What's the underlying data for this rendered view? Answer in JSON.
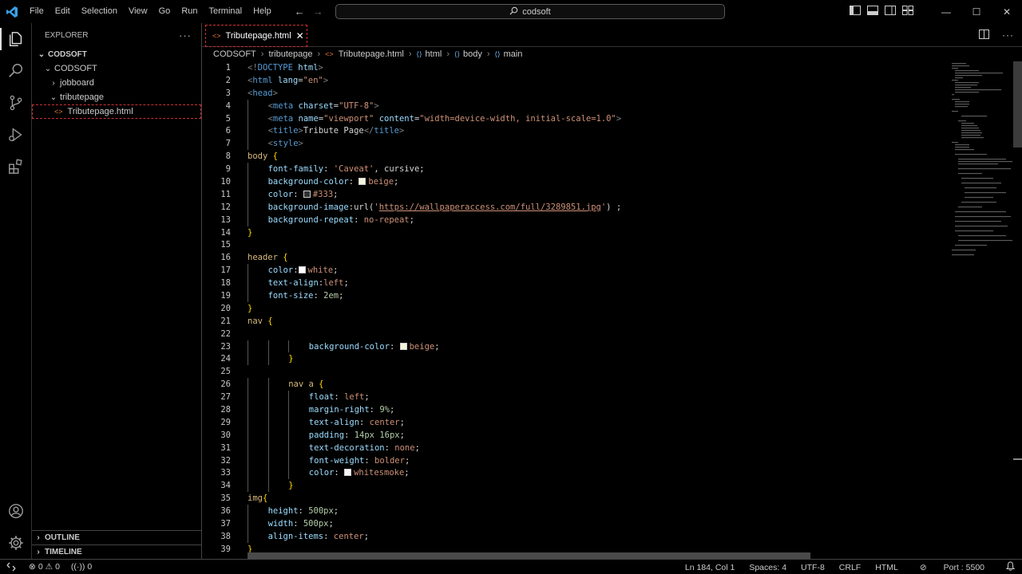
{
  "menu": [
    "File",
    "Edit",
    "Selection",
    "View",
    "Go",
    "Run",
    "Terminal",
    "Help"
  ],
  "search": {
    "text": "codsoft"
  },
  "explorer": {
    "title": "EXPLORER",
    "root": "CODSOFT",
    "folder": "CODSOFT",
    "items": [
      "jobboard",
      "tributepage"
    ],
    "file": "Tributepage.html",
    "outline": "OUTLINE",
    "timeline": "TIMELINE"
  },
  "tab": {
    "label": "Tributepage.html"
  },
  "breadcrumb": [
    "CODSOFT",
    "tributepage",
    "Tributepage.html",
    "html",
    "body",
    "main"
  ],
  "code": {
    "lines": [
      {
        "n": "1",
        "indent": 0,
        "parts": [
          [
            "t-punct",
            "<!"
          ],
          [
            "t-tag",
            "DOCTYPE"
          ],
          [
            "",
            ""
          ],
          [
            "t-attr",
            " html"
          ],
          [
            "t-punct",
            ">"
          ]
        ]
      },
      {
        "n": "2",
        "indent": 0,
        "parts": [
          [
            "t-punct",
            "<"
          ],
          [
            "t-tag",
            "html"
          ],
          [
            "t-attr",
            " lang"
          ],
          [
            "",
            "="
          ],
          [
            "t-str",
            "\"en\""
          ],
          [
            "t-punct",
            ">"
          ]
        ]
      },
      {
        "n": "3",
        "indent": 0,
        "parts": [
          [
            "t-punct",
            "<"
          ],
          [
            "t-tag",
            "head"
          ],
          [
            "t-punct",
            ">"
          ]
        ]
      },
      {
        "n": "4",
        "indent": 1,
        "parts": [
          [
            "t-punct",
            "<"
          ],
          [
            "t-tag",
            "meta"
          ],
          [
            "t-attr",
            " charset"
          ],
          [
            "",
            "="
          ],
          [
            "t-str",
            "\"UTF-8\""
          ],
          [
            "t-punct",
            ">"
          ]
        ]
      },
      {
        "n": "5",
        "indent": 1,
        "parts": [
          [
            "t-punct",
            "<"
          ],
          [
            "t-tag",
            "meta"
          ],
          [
            "t-attr",
            " name"
          ],
          [
            "",
            "="
          ],
          [
            "t-str",
            "\"viewport\""
          ],
          [
            "t-attr",
            " content"
          ],
          [
            "",
            "="
          ],
          [
            "t-str",
            "\"width=device-width, initial-scale=1.0\""
          ],
          [
            "t-punct",
            ">"
          ]
        ]
      },
      {
        "n": "6",
        "indent": 1,
        "parts": [
          [
            "t-punct",
            "<"
          ],
          [
            "t-tag",
            "title"
          ],
          [
            "t-punct",
            ">"
          ],
          [
            "",
            "Tribute Page"
          ],
          [
            "t-punct",
            "</"
          ],
          [
            "t-tag",
            "title"
          ],
          [
            "t-punct",
            ">"
          ]
        ]
      },
      {
        "n": "7",
        "indent": 1,
        "parts": [
          [
            "t-punct",
            "<"
          ],
          [
            "t-tag",
            "style"
          ],
          [
            "t-punct",
            ">"
          ]
        ]
      },
      {
        "n": "8",
        "indent": 0,
        "parts": [
          [
            "t-sel",
            "body"
          ],
          [
            "t-brace",
            " {"
          ]
        ]
      },
      {
        "n": "9",
        "indent": 1,
        "parts": [
          [
            "t-prop",
            "font-family"
          ],
          [
            "",
            ": "
          ],
          [
            "t-val",
            "'Caveat'"
          ],
          [
            "",
            ", cursive;"
          ]
        ]
      },
      {
        "n": "10",
        "indent": 1,
        "parts": [
          [
            "t-prop",
            "background-color"
          ],
          [
            "",
            ": "
          ],
          [
            "swatch",
            "#f5f5dc"
          ],
          [
            "t-val",
            "beige"
          ],
          [
            "",
            ";"
          ]
        ]
      },
      {
        "n": "11",
        "indent": 1,
        "parts": [
          [
            "t-prop",
            "color"
          ],
          [
            "",
            ": "
          ],
          [
            "swatch",
            "#333333"
          ],
          [
            "t-val",
            "#333"
          ],
          [
            "",
            ";"
          ]
        ]
      },
      {
        "n": "12",
        "indent": 1,
        "parts": [
          [
            "t-prop",
            "background-image"
          ],
          [
            "",
            ":url("
          ],
          [
            "t-val",
            "'"
          ],
          [
            "t-link",
            "https://wallpaperaccess.com/full/3289851.jpg"
          ],
          [
            "t-val",
            "'"
          ],
          [
            "",
            ") ;"
          ]
        ]
      },
      {
        "n": "13",
        "indent": 1,
        "parts": [
          [
            "t-prop",
            "background-repeat"
          ],
          [
            "",
            ": "
          ],
          [
            "t-val",
            "no-repeat"
          ],
          [
            "",
            ";"
          ]
        ]
      },
      {
        "n": "14",
        "indent": 0,
        "parts": [
          [
            "t-brace",
            "}"
          ]
        ]
      },
      {
        "n": "15",
        "indent": 0,
        "parts": []
      },
      {
        "n": "16",
        "indent": 0,
        "parts": [
          [
            "t-sel",
            "header"
          ],
          [
            "t-brace",
            " {"
          ]
        ]
      },
      {
        "n": "17",
        "indent": 1,
        "parts": [
          [
            "t-prop",
            "color"
          ],
          [
            "",
            ":"
          ],
          [
            "swatch",
            "#ffffff"
          ],
          [
            "t-val",
            "white"
          ],
          [
            "",
            ";"
          ]
        ]
      },
      {
        "n": "18",
        "indent": 1,
        "parts": [
          [
            "t-prop",
            "text-align"
          ],
          [
            "",
            ":"
          ],
          [
            "t-val",
            "left"
          ],
          [
            "",
            ";"
          ]
        ]
      },
      {
        "n": "19",
        "indent": 1,
        "parts": [
          [
            "t-prop",
            "font-size"
          ],
          [
            "",
            ": "
          ],
          [
            "t-num",
            "2em"
          ],
          [
            "",
            ";"
          ]
        ]
      },
      {
        "n": "20",
        "indent": 0,
        "parts": [
          [
            "t-brace",
            "}"
          ]
        ]
      },
      {
        "n": "21",
        "indent": 0,
        "parts": [
          [
            "t-sel",
            "nav"
          ],
          [
            "t-brace",
            " {"
          ]
        ]
      },
      {
        "n": "22",
        "indent": 0,
        "parts": []
      },
      {
        "n": "23",
        "indent": 3,
        "parts": [
          [
            "t-prop",
            "background-color"
          ],
          [
            "",
            ": "
          ],
          [
            "swatch",
            "#f5f5dc"
          ],
          [
            "t-val",
            "beige"
          ],
          [
            "",
            ";"
          ]
        ]
      },
      {
        "n": "24",
        "indent": 2,
        "parts": [
          [
            "t-brace",
            "}"
          ]
        ]
      },
      {
        "n": "25",
        "indent": 0,
        "parts": []
      },
      {
        "n": "26",
        "indent": 2,
        "parts": [
          [
            "t-sel",
            "nav a"
          ],
          [
            "t-brace",
            " {"
          ]
        ]
      },
      {
        "n": "27",
        "indent": 3,
        "parts": [
          [
            "t-prop",
            "float"
          ],
          [
            "",
            ": "
          ],
          [
            "t-val",
            "left"
          ],
          [
            "",
            ";"
          ]
        ]
      },
      {
        "n": "28",
        "indent": 3,
        "parts": [
          [
            "t-prop",
            "margin-right"
          ],
          [
            "",
            ": "
          ],
          [
            "t-num",
            "9%"
          ],
          [
            "",
            ";"
          ]
        ]
      },
      {
        "n": "29",
        "indent": 3,
        "parts": [
          [
            "t-prop",
            "text-align"
          ],
          [
            "",
            ": "
          ],
          [
            "t-val",
            "center"
          ],
          [
            "",
            ";"
          ]
        ]
      },
      {
        "n": "30",
        "indent": 3,
        "parts": [
          [
            "t-prop",
            "padding"
          ],
          [
            "",
            ": "
          ],
          [
            "t-num",
            "14px 16px"
          ],
          [
            "",
            ";"
          ]
        ]
      },
      {
        "n": "31",
        "indent": 3,
        "parts": [
          [
            "t-prop",
            "text-decoration"
          ],
          [
            "",
            ": "
          ],
          [
            "t-val",
            "none"
          ],
          [
            "",
            ";"
          ]
        ]
      },
      {
        "n": "32",
        "indent": 3,
        "parts": [
          [
            "t-prop",
            "font-weight"
          ],
          [
            "",
            ": "
          ],
          [
            "t-val",
            "bolder"
          ],
          [
            "",
            ";"
          ]
        ]
      },
      {
        "n": "33",
        "indent": 3,
        "parts": [
          [
            "t-prop",
            "color"
          ],
          [
            "",
            ": "
          ],
          [
            "swatch",
            "#f5f5f5"
          ],
          [
            "t-val",
            "whitesmoke"
          ],
          [
            "",
            ";"
          ]
        ]
      },
      {
        "n": "34",
        "indent": 2,
        "parts": [
          [
            "t-brace",
            "}"
          ]
        ]
      },
      {
        "n": "35",
        "indent": 0,
        "parts": [
          [
            "t-sel",
            "img"
          ],
          [
            "t-brace",
            "{"
          ]
        ]
      },
      {
        "n": "36",
        "indent": 1,
        "parts": [
          [
            "t-prop",
            "height"
          ],
          [
            "",
            ": "
          ],
          [
            "t-num",
            "500px"
          ],
          [
            "",
            ";"
          ]
        ]
      },
      {
        "n": "37",
        "indent": 1,
        "parts": [
          [
            "t-prop",
            "width"
          ],
          [
            "",
            ": "
          ],
          [
            "t-num",
            "500px"
          ],
          [
            "",
            ";"
          ]
        ]
      },
      {
        "n": "38",
        "indent": 1,
        "parts": [
          [
            "t-prop",
            "align-items"
          ],
          [
            "",
            ": "
          ],
          [
            "t-val",
            "center"
          ],
          [
            "",
            ";"
          ]
        ]
      },
      {
        "n": "39",
        "indent": 0,
        "parts": [
          [
            "t-brace",
            "}"
          ]
        ]
      }
    ]
  },
  "status": {
    "errors": "0",
    "warnings": "0",
    "ports": "0",
    "position": "Ln 184, Col 1",
    "spaces": "Spaces: 4",
    "encoding": "UTF-8",
    "eol": "CRLF",
    "language": "HTML",
    "port": "Port : 5500"
  }
}
